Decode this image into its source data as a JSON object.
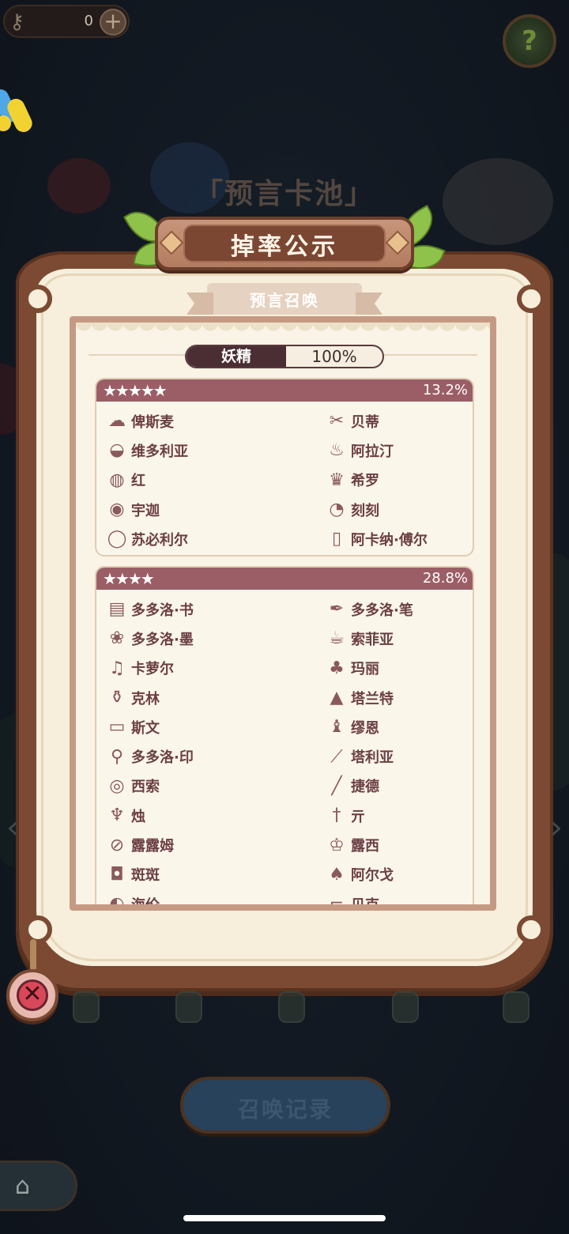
{
  "top_bar": {
    "key_count": "0",
    "plus_icon": "plus-icon",
    "help_icon": "question-icon"
  },
  "pool_title": "「预言卡池」",
  "panel": {
    "title": "掉率公示",
    "subtitle": "预言召唤",
    "type_tab": {
      "label": "妖精",
      "percent": "100%"
    }
  },
  "tiers": [
    {
      "stars": "★★★★★",
      "rate": "13.2%",
      "items": [
        {
          "name": "俾斯麦",
          "icon": "cloth-icon"
        },
        {
          "name": "贝蒂",
          "icon": "scissors-icon"
        },
        {
          "name": "维多利亚",
          "icon": "plate-icon"
        },
        {
          "name": "阿拉汀",
          "icon": "lamp-icon"
        },
        {
          "name": "红",
          "icon": "basket-icon"
        },
        {
          "name": "希罗",
          "icon": "crown-icon"
        },
        {
          "name": "宇迦",
          "icon": "cushion-icon"
        },
        {
          "name": "刻刻",
          "icon": "pocket-watch-icon"
        },
        {
          "name": "苏必利尔",
          "icon": "ring-icon"
        },
        {
          "name": "阿卡纳·傅尔",
          "icon": "tarot-card-icon"
        }
      ]
    },
    {
      "stars": "★★★★",
      "rate": "28.8%",
      "items": [
        {
          "name": "多多洛·书",
          "icon": "book-icon"
        },
        {
          "name": "多多洛·笔",
          "icon": "quill-icon"
        },
        {
          "name": "多多洛·墨",
          "icon": "ink-icon"
        },
        {
          "name": "索菲亚",
          "icon": "teacup-icon"
        },
        {
          "name": "卡萝尔",
          "icon": "music-box-icon"
        },
        {
          "name": "玛丽",
          "icon": "gourd-icon"
        },
        {
          "name": "克林",
          "icon": "watering-can-icon"
        },
        {
          "name": "塔兰特",
          "icon": "top-hat-icon"
        },
        {
          "name": "斯文",
          "icon": "box-icon"
        },
        {
          "name": "缪恩",
          "icon": "chess-piece-icon"
        },
        {
          "name": "多多洛·印",
          "icon": "seal-icon"
        },
        {
          "name": "塔利亚",
          "icon": "knife-icon"
        },
        {
          "name": "西索",
          "icon": "tape-icon"
        },
        {
          "name": "捷德",
          "icon": "needle-icon"
        },
        {
          "name": "烛",
          "icon": "candle-icon"
        },
        {
          "name": "亓",
          "icon": "dagger-icon"
        },
        {
          "name": "露露姆",
          "icon": "test-tube-icon"
        },
        {
          "name": "露西",
          "icon": "incense-burner-icon"
        },
        {
          "name": "斑斑",
          "icon": "barrel-icon"
        },
        {
          "name": "阿尔戈",
          "icon": "teapot-icon"
        },
        {
          "name": "海伦",
          "icon": "shell-icon"
        },
        {
          "name": "贝克",
          "icon": "boot-icon"
        }
      ]
    }
  ],
  "bottom": {
    "history_label": "召唤记录",
    "close_icon": "close-icon",
    "home_icon": "home-icon"
  },
  "colors": {
    "frame": "#7c4a32",
    "paper": "#f7efdc",
    "tier_header": "#9c5e66",
    "text": "#6b3f44"
  }
}
